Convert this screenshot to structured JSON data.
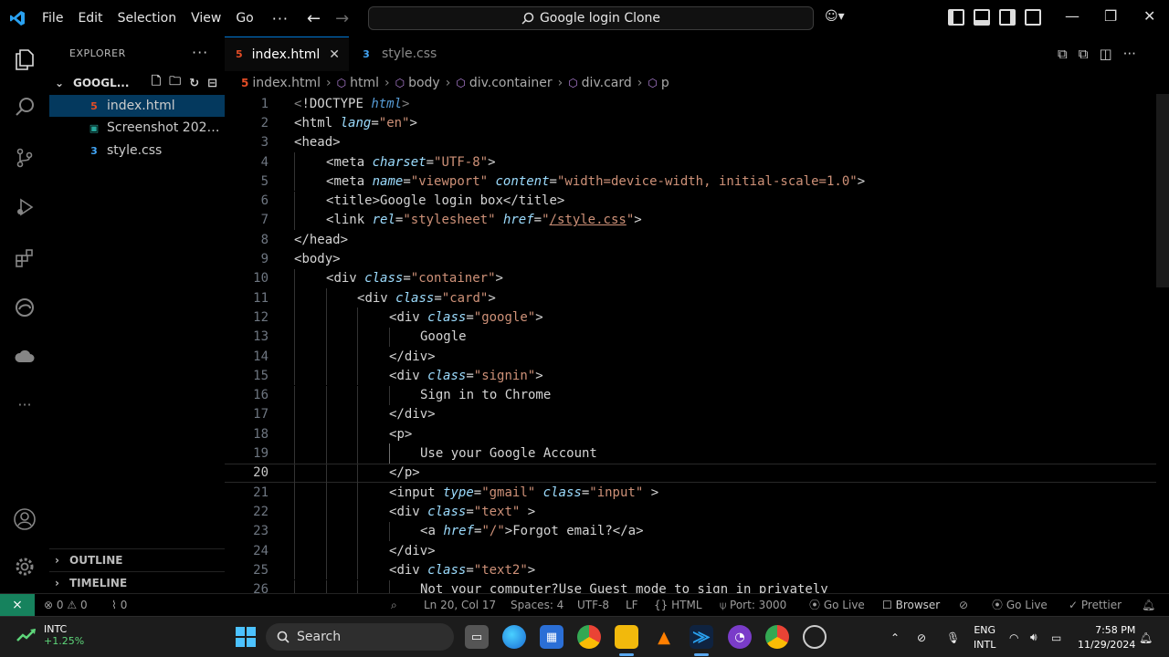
{
  "titlebar": {
    "menus": [
      "File",
      "Edit",
      "Selection",
      "View",
      "Go"
    ],
    "search_text": "Google login Clone"
  },
  "sidebar": {
    "title": "EXPLORER",
    "folder": "GOOGL...",
    "files": [
      {
        "name": "index.html",
        "icon": "html-file-icon",
        "selected": true
      },
      {
        "name": "Screenshot 2024-...",
        "icon": "image-file-icon",
        "selected": false
      },
      {
        "name": "style.css",
        "icon": "css-file-icon",
        "selected": false
      }
    ],
    "outline": "OUTLINE",
    "timeline": "TIMELINE"
  },
  "tabs": [
    {
      "label": "index.html",
      "active": true
    },
    {
      "label": "style.css",
      "active": false
    }
  ],
  "breadcrumb": [
    "index.html",
    "html",
    "body",
    "div.container",
    "div.card",
    "p"
  ],
  "code": {
    "current_line": 20,
    "lines": [
      "<!DOCTYPE html>",
      "<html lang=\"en\">",
      "<head>",
      "<meta charset=\"UTF-8\">",
      "<meta name=\"viewport\" content=\"width=device-width, initial-scale=1.0\">",
      "<title>Google login box</title>",
      "<link rel=\"stylesheet\" href=\"/style.css\">",
      "</head>",
      "<body>",
      "<div class=\"container\">",
      "<div class=\"card\">",
      "<div class=\"google\">",
      "Google",
      "</div>",
      "<div class=\"signin\">",
      "Sign in to Chrome",
      "</div>",
      "<p>",
      "Use your Google Account",
      "</p>",
      "<input type=\"gmail\" class=\"input\" >",
      "<div class=\"text\" >",
      "<a href=\"/\">Forgot email?</a>",
      "</div>",
      "<div class=\"text2\">",
      "Not your computer?Use Guest mode to sign in privately"
    ]
  },
  "statusbar": {
    "errors": "0",
    "warnings": "0",
    "ports": "0",
    "position": "Ln 20, Col 17",
    "spaces": "Spaces: 4",
    "encoding": "UTF-8",
    "eol": "LF",
    "language": "HTML",
    "port": "Port: 3000",
    "go_live": "Go Live",
    "browser": "Browser",
    "go_live2": "Go Live",
    "prettier": "Prettier"
  },
  "taskbar": {
    "stock_name": "INTC",
    "stock_change": "+1.25%",
    "search": "Search",
    "lang1": "ENG",
    "lang2": "INTL",
    "time": "7:58 PM",
    "date": "11/29/2024"
  },
  "colors": {
    "accent": "#0078d4",
    "html_icon": "#e44d26",
    "css_icon": "#42a5f5",
    "remote": "#16825d"
  }
}
